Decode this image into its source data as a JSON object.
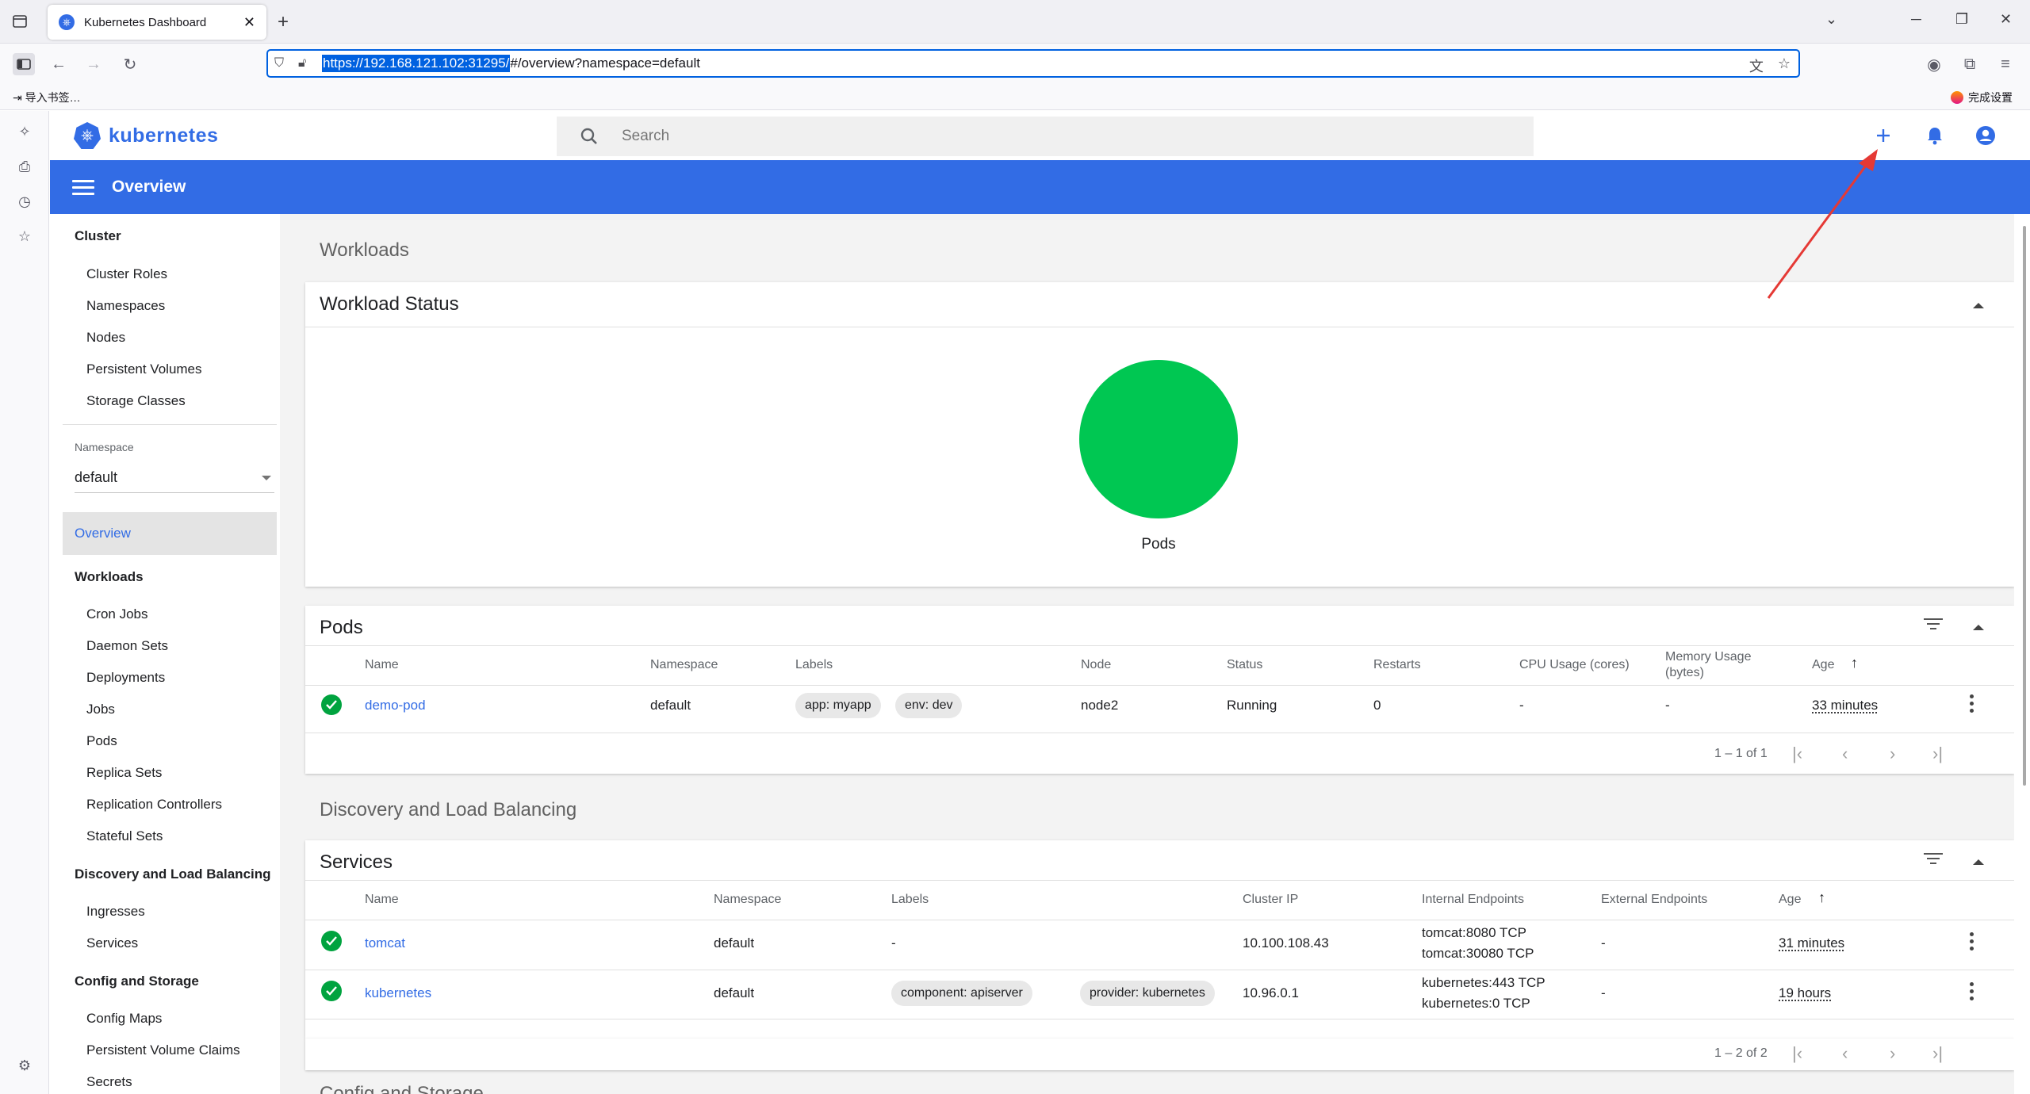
{
  "browser": {
    "tab_title": "Kubernetes Dashboard",
    "url_selected": "https://192.168.121.102:31295/",
    "url_rest": "#/overview?namespace=default",
    "bookmark_import": "导入书签…",
    "bookmark_setup": "完成设置"
  },
  "header": {
    "logo_text": "kubernetes",
    "search_placeholder": "Search"
  },
  "toolbar": {
    "title": "Overview"
  },
  "sidebar": {
    "cluster_title": "Cluster",
    "cluster_items": [
      "Cluster Roles",
      "Namespaces",
      "Nodes",
      "Persistent Volumes",
      "Storage Classes"
    ],
    "namespace_label": "Namespace",
    "namespace_value": "default",
    "overview_label": "Overview",
    "workloads_title": "Workloads",
    "workloads_items": [
      "Cron Jobs",
      "Daemon Sets",
      "Deployments",
      "Jobs",
      "Pods",
      "Replica Sets",
      "Replication Controllers",
      "Stateful Sets"
    ],
    "discovery_title": "Discovery and Load Balancing",
    "discovery_items": [
      "Ingresses",
      "Services"
    ],
    "config_title": "Config and Storage",
    "config_items": [
      "Config Maps",
      "Persistent Volume Claims",
      "Secrets"
    ]
  },
  "main": {
    "workloads_heading": "Workloads",
    "workload_status": {
      "title": "Workload Status",
      "chart_label": "Pods",
      "chart_color": "#00c752"
    },
    "pods": {
      "title": "Pods",
      "headers": [
        "Name",
        "Namespace",
        "Labels",
        "Node",
        "Status",
        "Restarts",
        "CPU Usage (cores)",
        "Memory Usage",
        "(bytes)",
        "Age"
      ],
      "rows": [
        {
          "name": "demo-pod",
          "namespace": "default",
          "labels": [
            "app: myapp",
            "env: dev"
          ],
          "node": "node2",
          "status": "Running",
          "restarts": "0",
          "cpu": "-",
          "memory": "-",
          "age": "33 minutes"
        }
      ],
      "pagination": "1 – 1 of 1"
    },
    "discovery_heading": "Discovery and Load Balancing",
    "services": {
      "title": "Services",
      "headers": [
        "Name",
        "Namespace",
        "Labels",
        "Cluster IP",
        "Internal Endpoints",
        "External Endpoints",
        "Age"
      ],
      "rows": [
        {
          "name": "tomcat",
          "namespace": "default",
          "labels": "-",
          "cluster_ip": "10.100.108.43",
          "internal": [
            "tomcat:8080 TCP",
            "tomcat:30080 TCP"
          ],
          "external": "-",
          "age": "31 minutes"
        },
        {
          "name": "kubernetes",
          "namespace": "default",
          "labels": [
            "component: apiserver",
            "provider: kubernetes"
          ],
          "cluster_ip": "10.96.0.1",
          "internal": [
            "kubernetes:443 TCP",
            "kubernetes:0 TCP"
          ],
          "external": "-",
          "age": "19 hours"
        }
      ],
      "pagination": "1 – 2 of 2"
    },
    "config_heading_partial": "Config and Storage"
  },
  "colors": {
    "accent": "#326ce5",
    "success": "#00a33f",
    "annotation_arrow": "#e53935"
  }
}
